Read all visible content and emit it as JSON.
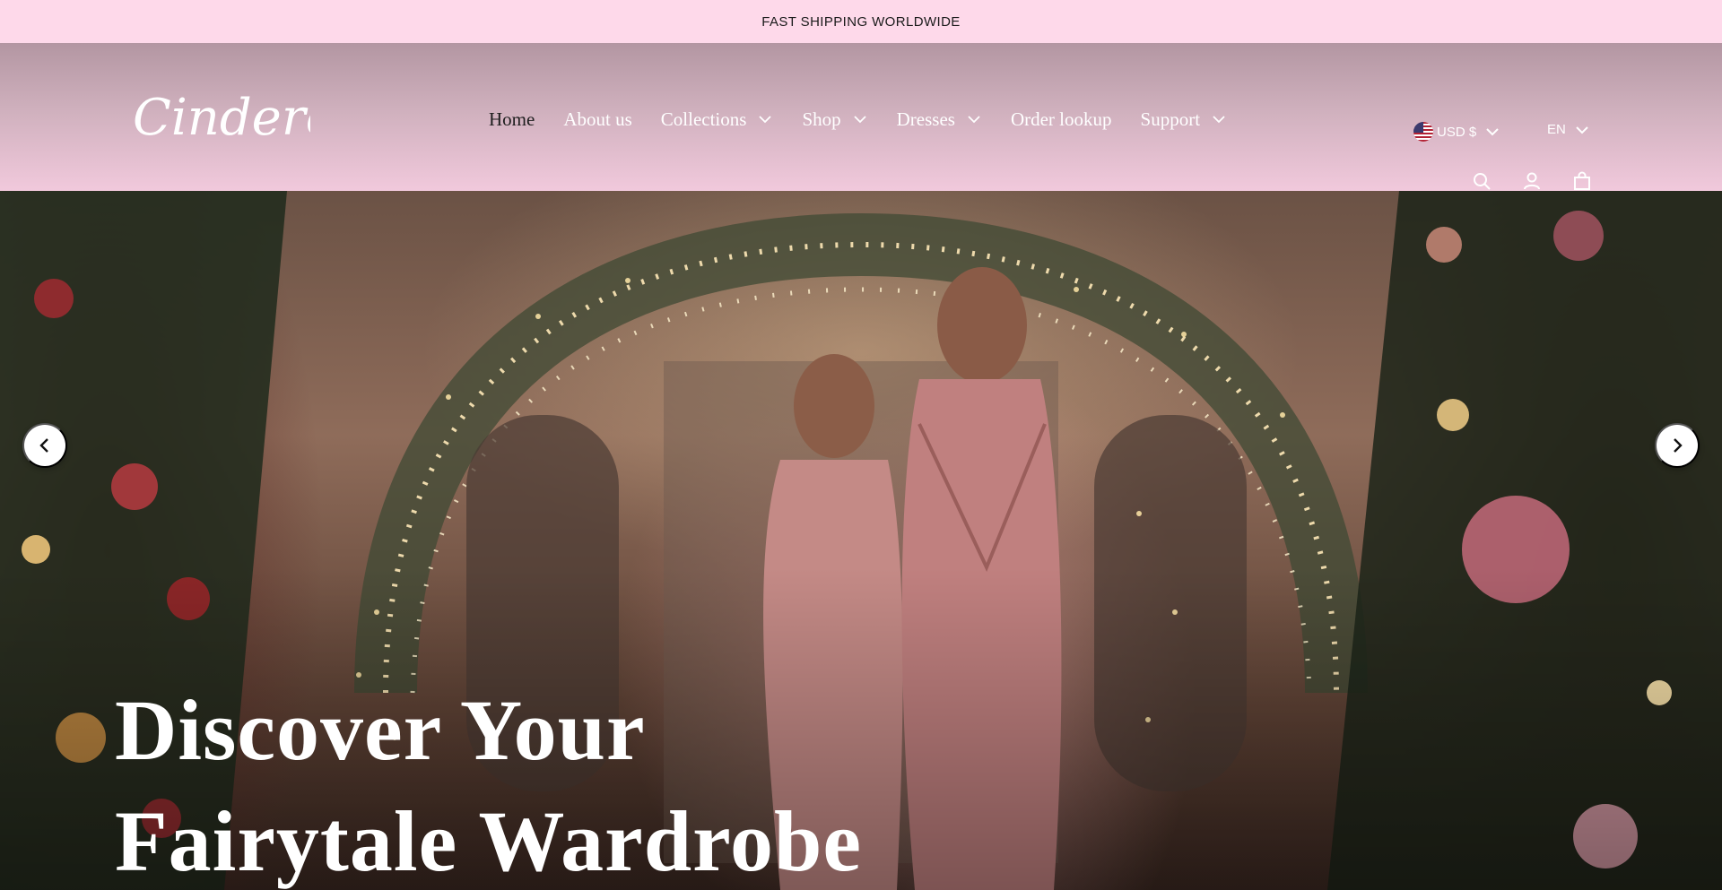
{
  "announcement": {
    "text": "FAST SHIPPING WORLDWIDE"
  },
  "header": {
    "logo_text": "Cinderella",
    "nav": [
      {
        "label": "Home",
        "active": true,
        "dropdown": false
      },
      {
        "label": "About us",
        "active": false,
        "dropdown": false
      },
      {
        "label": "Collections",
        "active": false,
        "dropdown": true
      },
      {
        "label": "Shop",
        "active": false,
        "dropdown": true
      },
      {
        "label": "Dresses",
        "active": false,
        "dropdown": true
      },
      {
        "label": "Order lookup",
        "active": false,
        "dropdown": false
      },
      {
        "label": "Support",
        "active": false,
        "dropdown": true
      }
    ],
    "currency": {
      "label": "USD $",
      "flag": "us-flag-icon"
    },
    "language": {
      "label": "EN"
    },
    "icons": [
      "search-icon",
      "account-icon",
      "cart-icon"
    ]
  },
  "hero": {
    "title_line1": "Discover Your",
    "title_line2": "Fairytale Wardrobe",
    "prev_icon": "chevron-left-icon",
    "next_icon": "chevron-right-icon"
  },
  "colors": {
    "announcement_bg": "#fed9ea",
    "header_gradient_top": "#b396a2",
    "header_gradient_bottom": "#f1c9dc",
    "active_nav": "#1e1e1e",
    "nav_text": "#ffffff"
  }
}
